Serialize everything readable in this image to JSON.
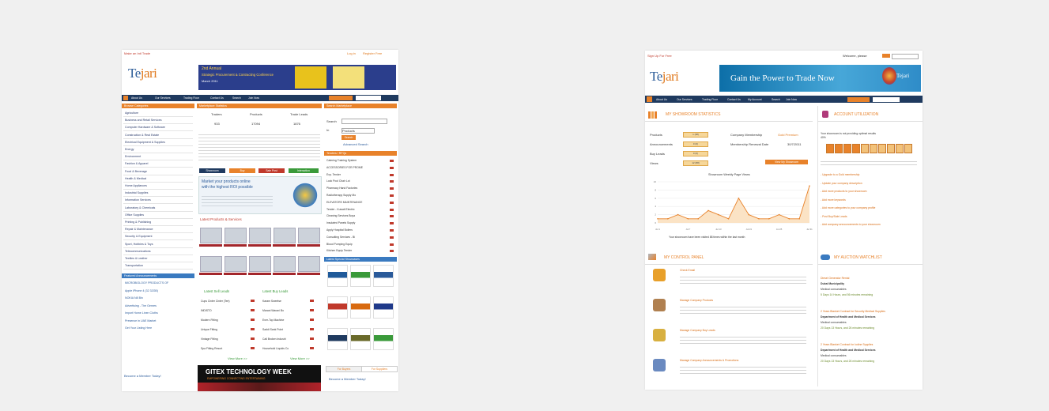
{
  "left_page": {
    "top_bar": {
      "tagline": "Make an Intl Trade",
      "login": "Log in",
      "register": "Register Free"
    },
    "logo": {
      "text_a": "Te",
      "text_b": "jari"
    },
    "banner": {
      "title": "2nd Annual",
      "subtitle": "Strategic Procurement & Contracting Conference",
      "dates": "March 2011"
    },
    "nav": [
      "About Us",
      "Our Services",
      "Trading Floor",
      "Contact Us",
      "Search",
      "Join Now"
    ],
    "categories": {
      "heading": "Browse Categories",
      "items": [
        "Agriculture",
        "Business and Retail Services",
        "Computer Hardware & Software",
        "Construction & Real Estate",
        "Electrical Equipment & Supplies",
        "Energy",
        "Environment",
        "Fashion & Apparel",
        "Food & Beverage",
        "Health & Medical",
        "Home Appliances",
        "Industrial Supplies",
        "Information Services",
        "Laboratory & Chemicals",
        "Office Supplies",
        "Printing & Publishing",
        "Repair & Maintenance",
        "Security & Equipment",
        "Sport, Hobbies & Toys",
        "Telecommunications",
        "Textiles & Leather",
        "Transportation"
      ]
    },
    "featured": {
      "heading": "Featured Announcements",
      "items": [
        "MICROBIOLOGY PRODUCTS OF",
        "Apple iPhone 4 (32 32GB)",
        "NOKIA N8 Bin",
        "Advertising - The Genres",
        "Import Home Linen Cloths",
        "Presence in UAE Market",
        "Get Your Listing Here"
      ]
    },
    "marketplace": {
      "heading": "Marketplace Statistics",
      "col1": "Traders",
      "col2": "Products",
      "col3": "Trade Leads",
      "val1": "933",
      "val2": "17094",
      "val3": "1876"
    },
    "search": {
      "heading": "Search Marketplace",
      "label_search": "Search",
      "label_in": "In",
      "select_value": "Products",
      "button": "Search",
      "advanced": "Advanced Search"
    },
    "showroom_tabs": [
      "Showroom",
      "Buy",
      "Sale Post",
      "Interaction"
    ],
    "promo": {
      "line1": "Market your products online",
      "line2": "with the highest ROI possible"
    },
    "latest_products": {
      "heading": "Latest Products & Services"
    },
    "sell_leads": {
      "heading": "Latest Sell Leads",
      "items": [
        "Cups Cinter Cinter (Tee)",
        "INDISTO",
        "Modern Fitting",
        "Unique Fitting",
        "Vintage Fitting",
        "Spa Fitting Resort"
      ],
      "more": "View More >>"
    },
    "buy_leads": {
      "heading": "Latest Buy Leads",
      "items": [
        "Karam Sweetse",
        "Marani Warani Bo",
        "Ever-Top Machine",
        "Saddi Sank Point",
        "Call Broken Industri",
        "Household Liquids Co"
      ],
      "more": "View More >>"
    },
    "tenders": {
      "heading": "Tenders / RFQs",
      "items": [
        "Catering Training System",
        "ACCESSORIES FOR PROME",
        "Exp. Tender",
        "Lock Pool Chair Lot",
        "Pharmacy Hand Factories",
        "Radiotherapy Supply Mo",
        "ELEVATORS MAINTENANCE",
        "Tender - Kuwait Electric",
        "Cleaning Services Boya",
        "Insulated Panels Supply",
        "Apply Hospital Boilers",
        "Consulting Services - Bi",
        "Blood Pumping Equip",
        "Kitchen Equip Tender"
      ]
    },
    "special_showcases": {
      "heading": "Latest Special Showcases"
    },
    "gitex": {
      "text": "GITEX TECHNOLOGY WEEK",
      "sub": "EMPOWERING   CONNECTING   ENTERTAINING"
    },
    "bottom_tabs": [
      "For Buyers",
      "For Suppliers"
    ],
    "become_member": "Become a Member Today!"
  },
  "right_page": {
    "top_bar": {
      "tagline": "Sign Up For Free",
      "search_hint": "Welcome, please"
    },
    "logo": {
      "text_a": "Te",
      "text_b": "jari"
    },
    "banner": {
      "text": "Gain the Power to Trade Now",
      "logo": "Tejari"
    },
    "nav": [
      "About Us",
      "Our Services",
      "Trading Floor",
      "Contact Us",
      "My Account",
      "Search",
      "Join Now"
    ],
    "stats": {
      "heading": "MY SHOWROOM STATISTICS",
      "labels": [
        "Products",
        "Announcements",
        "Buy Leads",
        "Views"
      ],
      "values": [
        "1 (38)",
        "0 (0)",
        "0 (0)",
        "12 (88)"
      ],
      "membership_label": "Company Membership",
      "membership_value": "Gold Premium",
      "expiry_label": "Membership Renewal Date",
      "expiry_value": "30/7/2011",
      "button": "View My Showroom",
      "chart_title": "Showroom Weekly Page Views",
      "footnote": "Your showroom have been visited 88 times within the last month"
    },
    "account": {
      "heading": "ACCOUNT UTILIZATION",
      "intro": "Your showroom is not providing optimal results",
      "percent": "40%",
      "advice": "You can increase the rating and attract more visitors to your showroom by addressing the following issues:",
      "issues": [
        "Upgrade to a Gold membership",
        "Update your company description",
        "Add more products to your showroom",
        "Add more keywords",
        "Add more categories to your company profile",
        "Post Buy/Sale Leads",
        "Add company announcements to your showroom"
      ]
    },
    "control_panel": {
      "heading": "MY CONTROL PANEL",
      "items": [
        {
          "title": "Check Email",
          "desc": "Check secure email, communicate with suppliers and buyers, receive direct requests, buy leads and reply to inquiries."
        },
        {
          "title": "Manage Company Products",
          "desc": "Add or update your products, activate and deactivate your products as much information as possible to enable consumers to find them."
        },
        {
          "title": "Manage Company Buy Leads",
          "desc": "Add and update trade leads, express your desire to buy products or services and the offered prices."
        },
        {
          "title": "Manage Company Announcements & Promotions",
          "desc": "Add or edit your announcements, show your promotions and special offers and latest company news to consumers."
        }
      ]
    },
    "auction": {
      "heading": "MY AUCTION WATCHLIST",
      "items": [
        {
          "title": "Diesel Generator Rental",
          "org": "Dubai Municipality",
          "type": "Medical consumables",
          "time": "5 Days 14 Hours, and 56 minutes remaining"
        },
        {
          "title": "2 Years Blanket Contract for Security Medical Supplies",
          "org": "Department of Health and Medical Services",
          "type": "Medical consumables",
          "time": "20 Days 13 Hours, and 26 minutes remaining"
        },
        {
          "title": "2 Years Blanket Contract for Iodine Supplies",
          "org": "Department of Health and Medical Services",
          "type": "Medical consumables",
          "time": "20 Days 13 Hours, and 26 minutes remaining"
        }
      ]
    }
  },
  "chart_data": {
    "type": "line",
    "title": "Showroom Weekly Page Views",
    "x": [
      "Jul 1",
      "Jul 3",
      "Jul 5",
      "Jul 7",
      "Jul 9",
      "Jul 11",
      "Jul 13",
      "Jul 15",
      "Jul 17",
      "Jul 19",
      "Jul 21",
      "Jul 23",
      "Jul 25",
      "Jul 27",
      "Jul 29",
      "Jul 31"
    ],
    "series": [
      {
        "values": [
          1,
          1,
          2,
          1,
          1,
          3,
          2,
          1,
          6,
          2,
          1,
          1,
          2,
          1,
          1,
          9
        ]
      }
    ],
    "ylim": [
      0,
      10
    ],
    "grid": true
  },
  "colors": {
    "brand_blue": "#1f3a5f",
    "accent_orange": "#e8822a",
    "leads_red": "#a3262b"
  }
}
